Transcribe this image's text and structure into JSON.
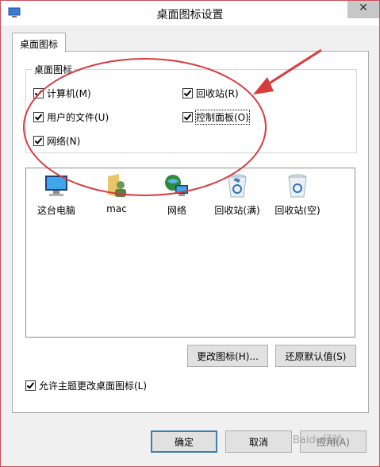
{
  "window": {
    "title": "桌面图标设置",
    "close_glyph": "✕"
  },
  "tab": {
    "label": "桌面图标"
  },
  "group": {
    "label": "桌面图标",
    "checkboxes": [
      {
        "label": "计算机(M)",
        "checked": true
      },
      {
        "label": "回收站(R)",
        "checked": true
      },
      {
        "label": "用户的文件(U)",
        "checked": true
      },
      {
        "label": "控制面板(O)",
        "checked": true
      },
      {
        "label": "网络(N)",
        "checked": true
      }
    ]
  },
  "icons": [
    {
      "label": "这台电脑",
      "icon": "computer-icon"
    },
    {
      "label": "mac",
      "icon": "user-folder-icon"
    },
    {
      "label": "网络",
      "icon": "network-icon"
    },
    {
      "label": "回收站(满)",
      "icon": "recycle-bin-full-icon"
    },
    {
      "label": "回收站(空)",
      "icon": "recycle-bin-empty-icon"
    }
  ],
  "buttons": {
    "change_icon": "更改图标(H)...",
    "restore_default": "还原默认值(S)",
    "ok": "确定",
    "cancel": "取消",
    "apply": "应用(A)"
  },
  "allow_themes": {
    "label": "允许主题更改桌面图标(L)",
    "checked": true
  },
  "annotation": {
    "color": "#d83a40"
  },
  "watermark": "Baidu经验"
}
